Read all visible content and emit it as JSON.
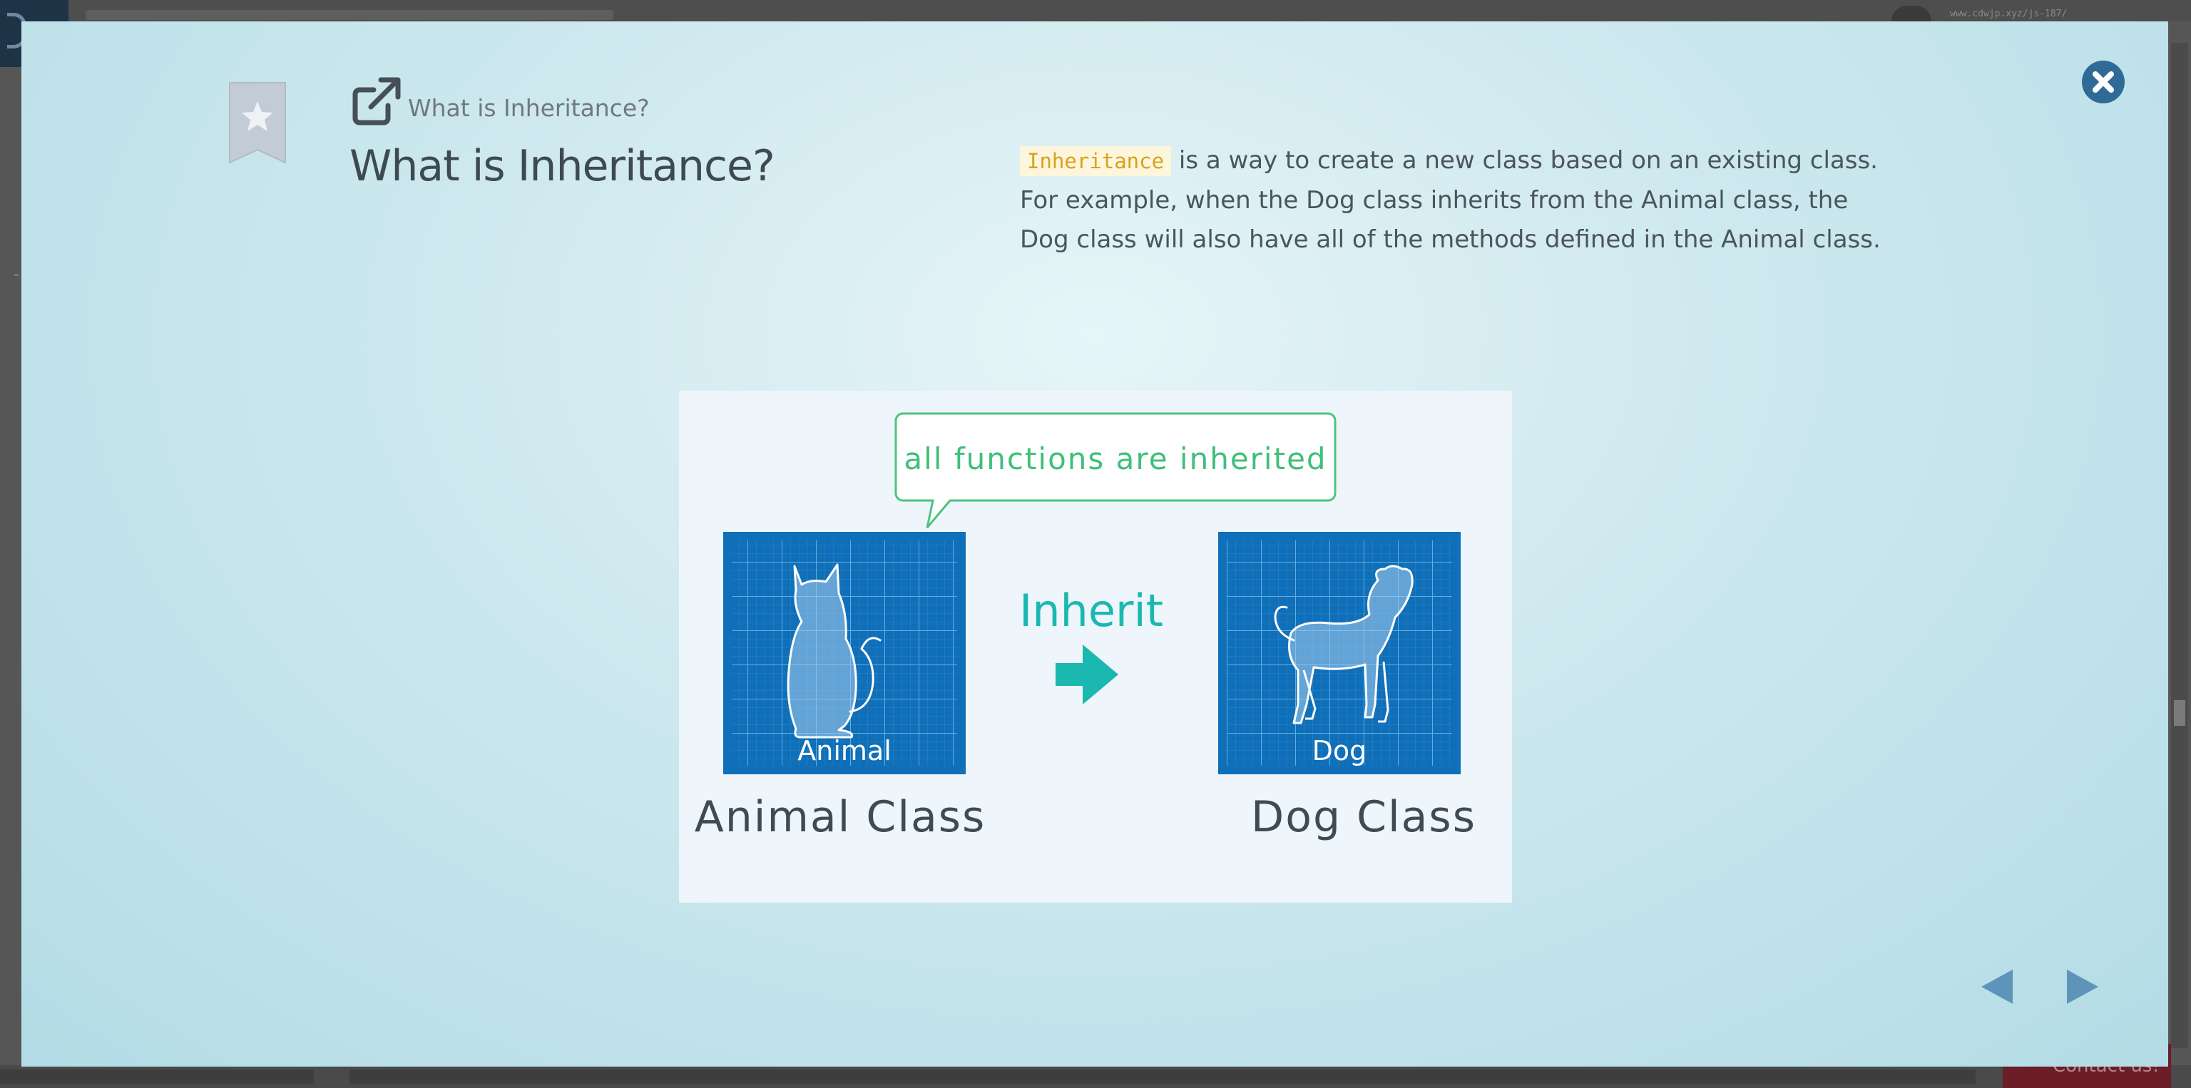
{
  "background": {
    "url_snippet": "www.cdwjp.xyz/js-187/",
    "contact_label": "Contact us!"
  },
  "modal": {
    "breadcrumb": "What is Inheritance?",
    "title": "What is Inheritance?",
    "description": {
      "term": "Inheritance",
      "line1_rest": " is a way to create a new class based on an existing class.",
      "line2": "For example, when the Dog class inherits from the Animal class, the",
      "line3": "Dog class will also have all of the methods defined in the Animal class."
    },
    "figure": {
      "speech_bubble": "all functions are inherited",
      "parent_tile_label": "Animal",
      "parent_caption": "Animal Class",
      "arrow_label": "Inherit",
      "child_tile_label": "Dog",
      "child_caption": "Dog Class"
    }
  },
  "colors": {
    "tile_blue": "#0f6fb8",
    "teal": "#1bb8b0",
    "bubble_green": "#4cc47e",
    "nav_arrow": "#5f94ba",
    "close_bg": "#2f6b96",
    "code_text": "#d9a21c"
  },
  "icons": {
    "bookmark": "bookmark-star-icon",
    "link": "external-link-icon",
    "close": "close-circle-icon",
    "prev": "triangle-left-icon",
    "next": "triangle-right-icon"
  }
}
